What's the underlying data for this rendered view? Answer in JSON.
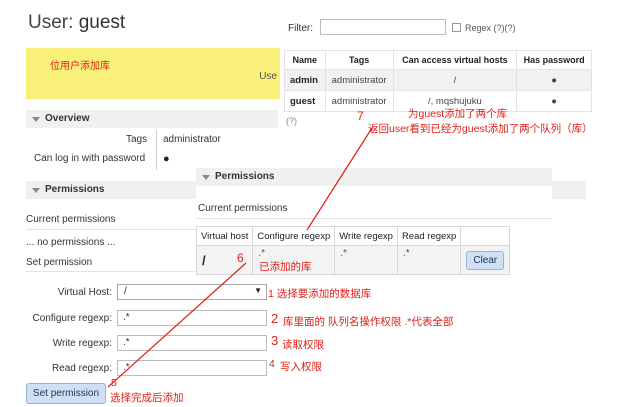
{
  "title": {
    "prefix": "User:",
    "name": "guest"
  },
  "yellow_note": {
    "text": "位用户添加库",
    "suffix": "Use"
  },
  "filter": {
    "label": "Filter:",
    "value": "",
    "regex_label": "Regex (?)(?)"
  },
  "users_table": {
    "headers": [
      "Name",
      "Tags",
      "Can access virtual hosts",
      "Has password"
    ],
    "rows": [
      [
        "admin",
        "administrator",
        "/",
        "●"
      ],
      [
        "guest",
        "administrator",
        "/, mqshujuku",
        "●"
      ]
    ]
  },
  "help_q": "(?)",
  "overview": {
    "label": "Overview",
    "tags_label": "Tags",
    "tags_value": "administrator",
    "login_label": "Can log in with password",
    "login_value": "●"
  },
  "permissions_left": {
    "label": "Permissions",
    "current": "Current permissions",
    "none": "... no permissions ...",
    "set": "Set permission"
  },
  "permissions_overlay": {
    "label": "Permissions",
    "current": "Current permissions",
    "headers": [
      "Virtual host",
      "Configure regexp",
      "Write regexp",
      "Read regexp"
    ],
    "row": {
      "vhost": "/",
      "configure": ".*",
      "write": ".*",
      "read": ".*"
    },
    "clear": "Clear"
  },
  "form": {
    "vhost_label": "Virtual Host:",
    "vhost_value": "/",
    "configure_label": "Configure regexp:",
    "configure_value": ".*",
    "write_label": "Write regexp:",
    "write_value": ".*",
    "read_label": "Read regexp:",
    "read_value": ".*",
    "submit": "Set permission"
  },
  "annotations": {
    "a1": "1 选择要添加的数据库",
    "a2n": "2",
    "a2": "库里面的 队列名操作权限 .*代表全部",
    "a3n": "3",
    "a3": "读取权限",
    "a4n": "4",
    "a4": "写入权限",
    "a5n": "5",
    "a5": "选择完成后添加",
    "a6n": "6",
    "a6": "已添加的库",
    "a7n": "7",
    "a7a": "为guest添加了两个库",
    "a7b": "返回user看到已经为guest添加了两个队列（库）"
  },
  "colors": {
    "annotation_red": "#e0201b",
    "note_yellow": "#f9f07a",
    "button_blue": "#cfe0f4"
  }
}
